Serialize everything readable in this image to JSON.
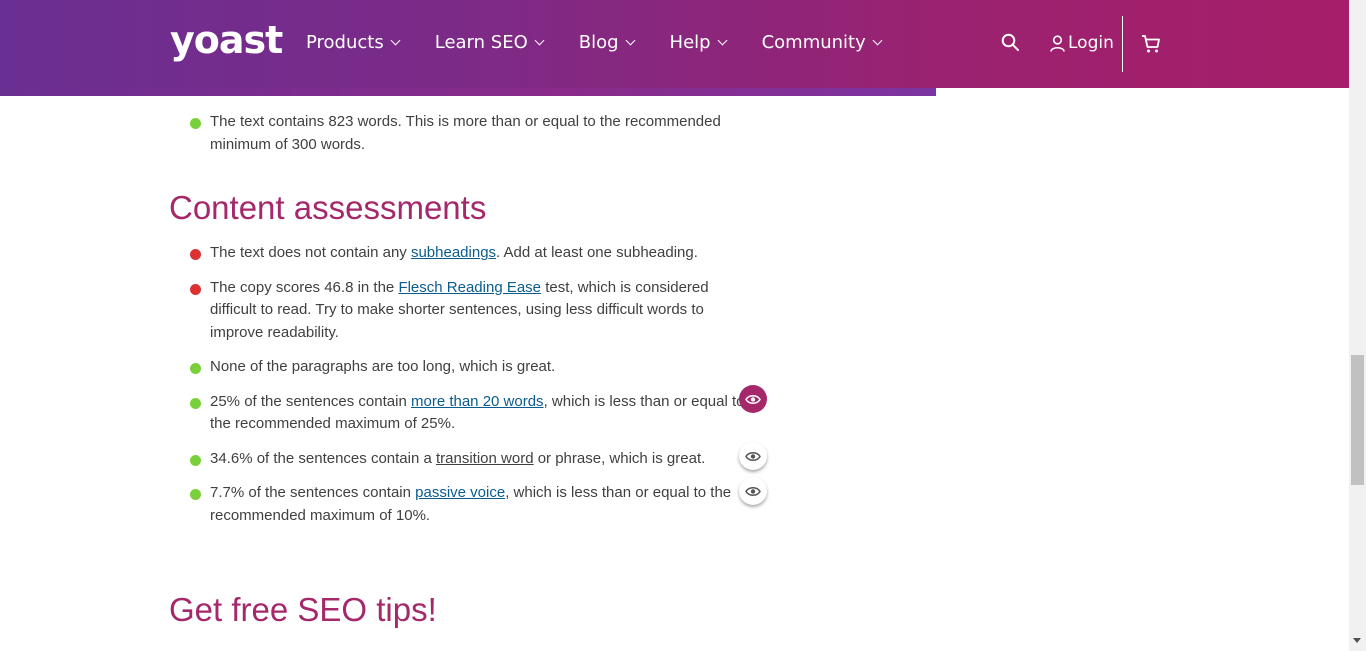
{
  "header": {
    "logo": "yoast",
    "nav": [
      {
        "label": "Products"
      },
      {
        "label": "Learn SEO"
      },
      {
        "label": "Blog"
      },
      {
        "label": "Help"
      },
      {
        "label": "Community"
      }
    ],
    "login_label": "Login",
    "icons": [
      "search-icon",
      "user-icon",
      "cart-icon"
    ]
  },
  "top_item": {
    "text": "The text contains 823 words. This is more than or equal to the recommended minimum of 300 words.",
    "status": "green"
  },
  "content_assessments": {
    "title": "Content assessments",
    "items": [
      {
        "status": "red",
        "before": "The text does not contain any ",
        "link": "subheadings",
        "after": ". Add at least one subheading."
      },
      {
        "status": "red",
        "before": "The copy scores 46.8 in the ",
        "link": "Flesch Reading Ease",
        "after": " test, which is considered difficult to read. Try to make shorter sentences, using less difficult words to improve readability."
      },
      {
        "status": "green",
        "before": "None of the paragraphs are too long, which is great.",
        "link": "",
        "after": ""
      },
      {
        "status": "green",
        "before": "25% of the sentences contain ",
        "link": "more than 20 words",
        "after": ", which is less than or equal to the recommended maximum of 25%."
      },
      {
        "status": "green",
        "before": "34.6% of the sentences contain a ",
        "link": "transition word",
        "after": " or phrase, which is great."
      },
      {
        "status": "green",
        "before": "7.7% of the sentences contain ",
        "link": "passive voice",
        "after": ", which is less than or equal to the recommended maximum of 10%."
      }
    ]
  },
  "tips_title": "Get free SEO tips!",
  "colors": {
    "accent": "#a4286a",
    "good": "#7ad03a",
    "bad": "#dc3232",
    "link": "#0b5c8e"
  }
}
